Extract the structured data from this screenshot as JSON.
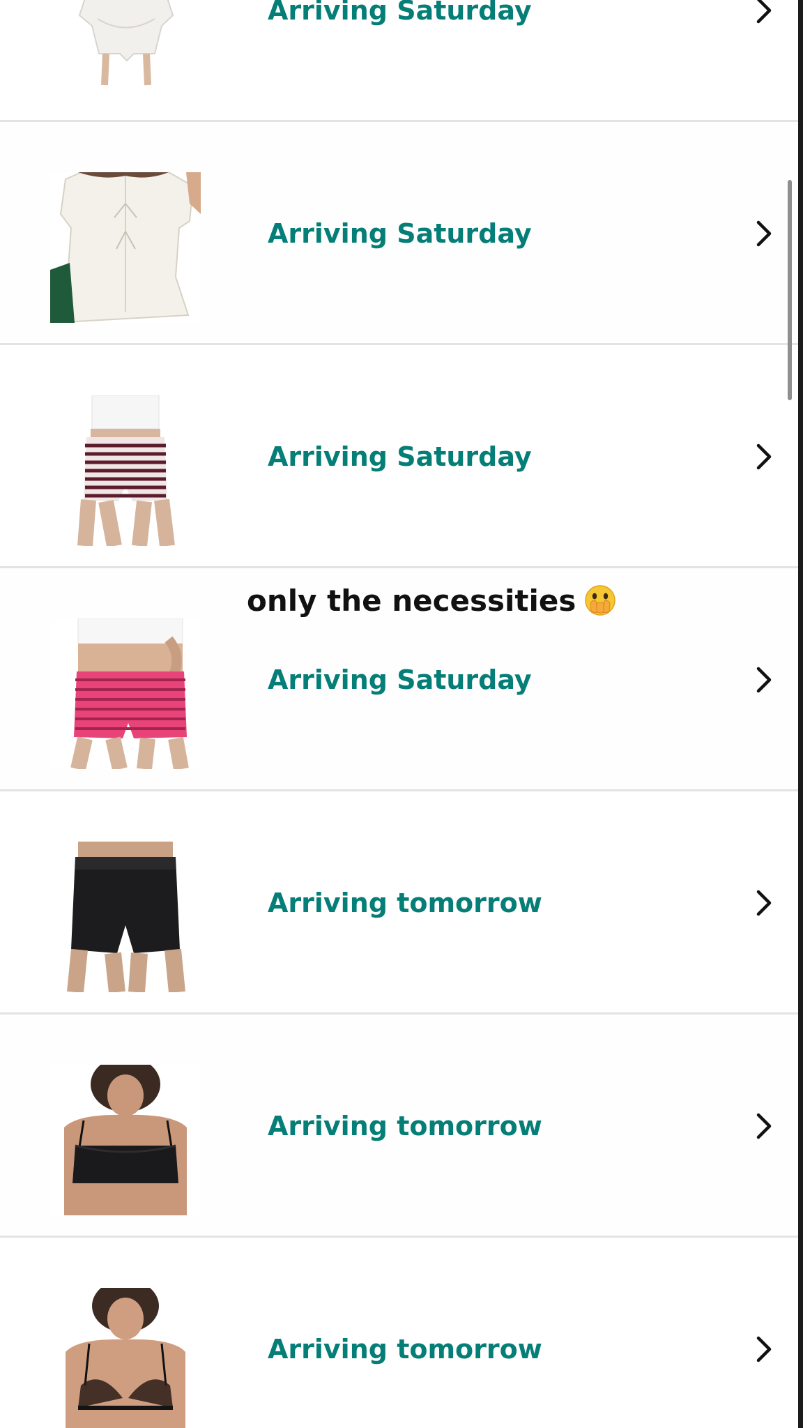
{
  "orders": [
    {
      "status": "Arriving Saturday",
      "item_icon": "white-ruffle-set-icon"
    },
    {
      "status": "Arriving Saturday",
      "item_icon": "white-tie-front-top-icon"
    },
    {
      "status": "Arriving Saturday",
      "item_icon": "striped-shorts-maroon-icon"
    },
    {
      "status": "Arriving Saturday",
      "item_icon": "striped-shorts-pink-icon"
    },
    {
      "status": "Arriving tomorrow",
      "item_icon": "black-biker-shorts-icon"
    },
    {
      "status": "Arriving tomorrow",
      "item_icon": "black-bralette-icon"
    },
    {
      "status": "Arriving tomorrow",
      "item_icon": "black-sheer-bra-icon"
    }
  ],
  "overlay": {
    "caption": "only the necessities",
    "emoji_icon": "face-with-open-eyes-and-hand-over-mouth-icon"
  },
  "colors": {
    "status_text": "#047e76",
    "divider": "#e3e3e3",
    "chevron": "#111111"
  }
}
